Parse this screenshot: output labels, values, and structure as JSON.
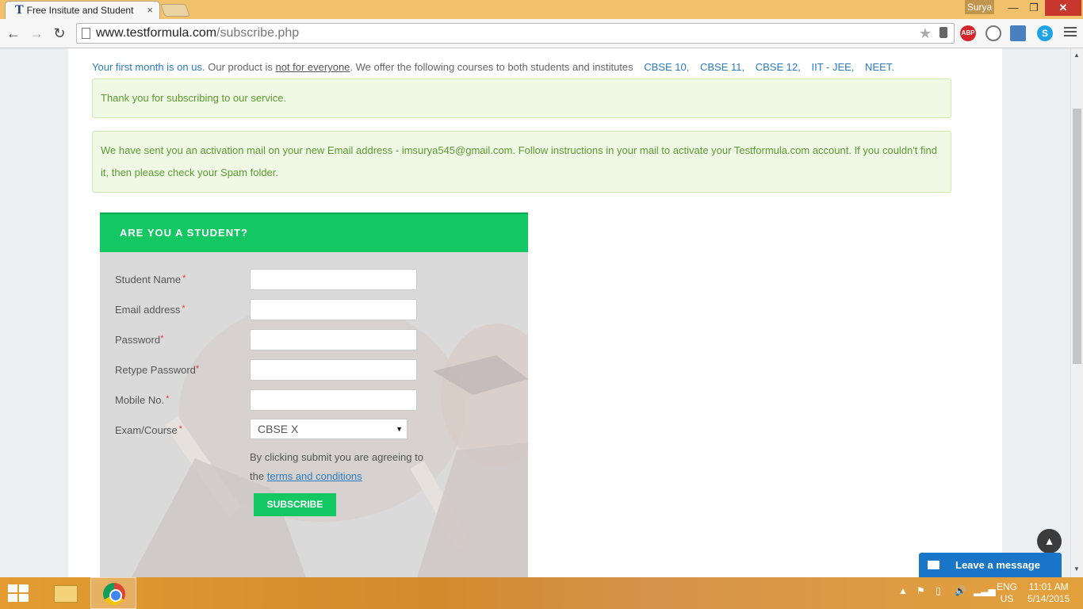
{
  "browser": {
    "tab_title": "Free Insitute and Student",
    "favicon_letter": "T",
    "profile_name": "Surya",
    "url_host": "www.testformula.com",
    "url_path": "/subscribe.php",
    "extensions": [
      "abp-icon",
      "globe-icon",
      "download-icon",
      "skype-icon"
    ],
    "abp_label": "ABP"
  },
  "page": {
    "promo": {
      "highlight": "Your first month is on us.",
      "text_before": " Our product is ",
      "underlined": "not for everyone",
      "text_after": ". We offer the following courses to both students and institutes",
      "courses": [
        "CBSE 10,",
        "CBSE 11,",
        "CBSE 12,",
        "IIT - JEE,",
        "NEET."
      ]
    },
    "alert_thanks": "Thank you for subscribing to our service.",
    "alert_activation": "We have sent you an activation mail on your new Email address - imsurya545@gmail.com. Follow instructions in your mail to activate your Testformula.com account. If you couldn't find it, then please check your Spam folder.",
    "form": {
      "heading": "ARE YOU A STUDENT?",
      "fields": {
        "student_name": "Student Name",
        "email": "Email address",
        "password": "Password",
        "retype_password": "Retype Password",
        "mobile": "Mobile No.",
        "course": "Exam/Course"
      },
      "required_mark": "*",
      "course_selected": "CBSE X",
      "agree_text": "By clicking submit you are agreeing to the",
      "terms_link": "terms and conditions",
      "submit_label": "SUBSCRIBE"
    },
    "leave_message": "Leave a message"
  },
  "taskbar": {
    "lang_top": "ENG",
    "lang_bottom": "US",
    "time": "11:01 AM",
    "date": "5/14/2015"
  },
  "colors": {
    "accent_green": "#13c763",
    "link_blue": "#2b7bbf",
    "alert_bg": "#f0f9e6",
    "alert_text": "#5b9a2f",
    "chat_blue": "#1975c7"
  }
}
